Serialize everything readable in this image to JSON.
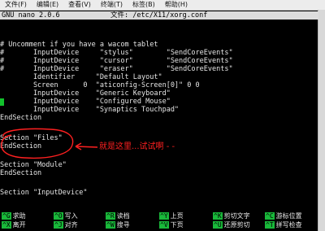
{
  "menubar": {
    "items": [
      "文件(F)",
      "编辑(E)",
      "查看(V)",
      "终端(T)",
      "标签(B)",
      "帮助(H)"
    ]
  },
  "titlebar": {
    "app": "GNU nano 2.0.6",
    "file": "文件: /etc/X11/xorg.conf"
  },
  "editor": {
    "lines": [
      "# Uncomment if you have a wacom tablet",
      "#       InputDevice     \"stylus\"        \"SendCoreEvents\"",
      "#       InputDevice     \"cursor\"        \"SendCoreEvents\"",
      "#       InputDevice     \"eraser\"        \"SendCoreEvents\"",
      "        Identifier     \"Default Layout\"",
      "        Screen      0  \"aticonfig-Screen[0]\" 0 0",
      "        InputDevice    \"Generic Keyboard\"",
      "        InputDevice    \"Configured Mouse\"",
      "        InputDevice    \"Synaptics Touchpad\"",
      "EndSection",
      "",
      "Section \"Files\"",
      "EndSection",
      "",
      "Section \"Module\"",
      "EndSection",
      "",
      "Section \"InputDevice\""
    ]
  },
  "annotation": {
    "text": "就是这里...试试啊 - -",
    "color": "#ff2020"
  },
  "shortcuts": {
    "row1": [
      {
        "key": "^G",
        "label": "求助"
      },
      {
        "key": "^O",
        "label": "写入"
      },
      {
        "key": "^R",
        "label": "读档"
      },
      {
        "key": "^Y",
        "label": "上页"
      },
      {
        "key": "^K",
        "label": "剪切文字"
      },
      {
        "key": "^C",
        "label": "游标位置"
      }
    ],
    "row2": [
      {
        "key": "^X",
        "label": "离开"
      },
      {
        "key": "^J",
        "label": "对齐"
      },
      {
        "key": "^W",
        "label": "搜寻"
      },
      {
        "key": "^V",
        "label": "下页"
      },
      {
        "key": "^U",
        "label": "还原剪切"
      },
      {
        "key": "^T",
        "label": "拼写检查"
      }
    ]
  },
  "colors": {
    "shortcut_key_bg": "#19b83a",
    "cursor": "#12c12c",
    "annotation": "#ff2020"
  }
}
